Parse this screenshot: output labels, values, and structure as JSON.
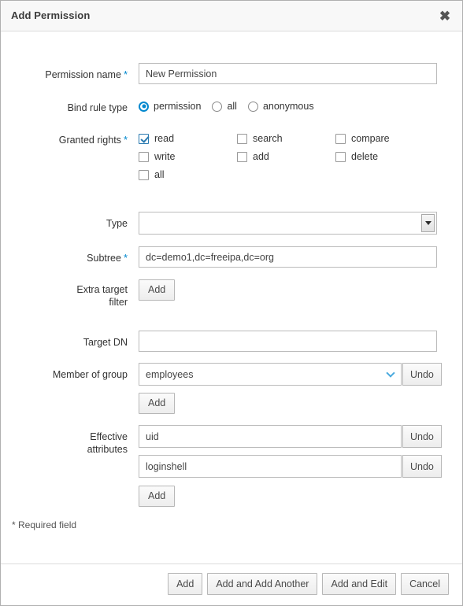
{
  "dialog": {
    "title": "Add Permission",
    "close_icon": "close-icon",
    "required_note": "* Required field"
  },
  "fields": {
    "permission_name": {
      "label": "Permission name",
      "required": "*",
      "value": "New Permission"
    },
    "bind_rule_type": {
      "label": "Bind rule type",
      "options": [
        {
          "label": "permission",
          "selected": true
        },
        {
          "label": "all",
          "selected": false
        },
        {
          "label": "anonymous",
          "selected": false
        }
      ]
    },
    "granted_rights": {
      "label": "Granted rights",
      "required": "*",
      "options": [
        {
          "label": "read",
          "checked": true
        },
        {
          "label": "search",
          "checked": false
        },
        {
          "label": "compare",
          "checked": false
        },
        {
          "label": "write",
          "checked": false
        },
        {
          "label": "add",
          "checked": false
        },
        {
          "label": "delete",
          "checked": false
        },
        {
          "label": "all",
          "checked": false
        }
      ]
    },
    "type": {
      "label": "Type",
      "value": "",
      "dropdown_icon": "triangle-down-icon"
    },
    "subtree": {
      "label": "Subtree",
      "required": "*",
      "value": "dc=demo1,dc=freeipa,dc=org"
    },
    "extra_target_filter": {
      "label_line1": "Extra target",
      "label_line2": "filter",
      "add_label": "Add"
    },
    "target_dn": {
      "label": "Target DN",
      "value": ""
    },
    "member_of_group": {
      "label": "Member of group",
      "value": "employees",
      "chevron_icon": "chevron-down-icon",
      "undo_label": "Undo",
      "add_label": "Add"
    },
    "effective_attributes": {
      "label_line1": "Effective",
      "label_line2": "attributes",
      "rows": [
        {
          "value": "uid",
          "undo_label": "Undo"
        },
        {
          "value": "loginshell",
          "undo_label": "Undo"
        }
      ],
      "add_label": "Add"
    }
  },
  "footer": {
    "buttons": [
      {
        "label": "Add"
      },
      {
        "label": "Add and Add Another"
      },
      {
        "label": "Add and Edit"
      },
      {
        "label": "Cancel"
      }
    ]
  },
  "colors": {
    "accent": "#0088ce",
    "checkbox_checked": "#2a7ab0",
    "header_bg": "#f8f8f8",
    "text": "#333333"
  }
}
